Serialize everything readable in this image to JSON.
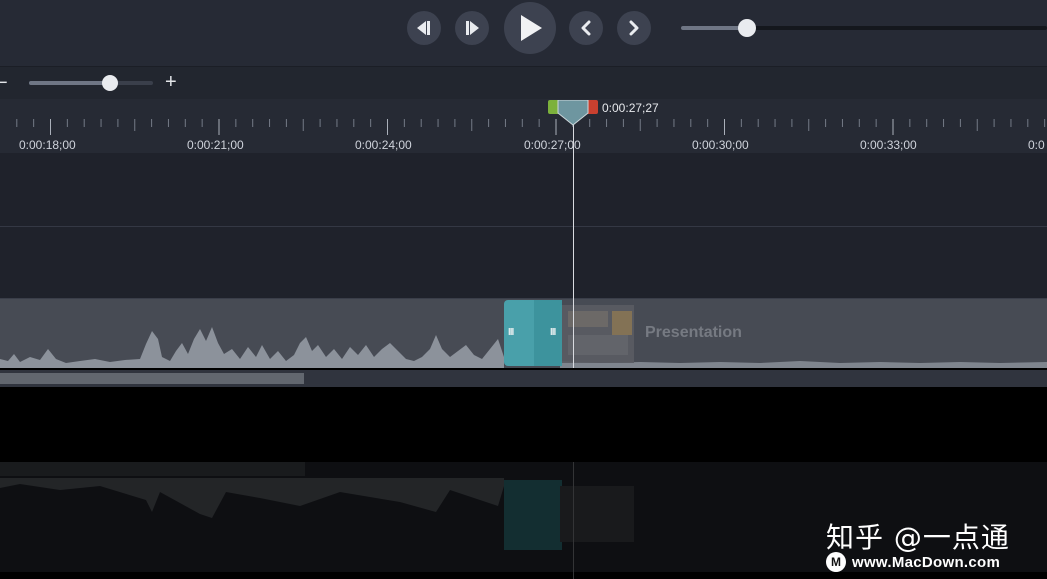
{
  "player": {
    "buttons": [
      {
        "name": "step-back-button",
        "icon": "skip-back-icon"
      },
      {
        "name": "step-forward-button",
        "icon": "skip-forward-icon"
      },
      {
        "name": "play-button",
        "icon": "play-icon"
      },
      {
        "name": "previous-button",
        "icon": "chevron-left-icon"
      },
      {
        "name": "next-button",
        "icon": "chevron-right-icon"
      }
    ],
    "progress_fraction": 0.18
  },
  "zoom": {
    "minus_label": "−",
    "plus_label": "+",
    "level_fraction": 0.65
  },
  "timeline": {
    "ruler_labels": [
      "0:00:18;00",
      "0:00:21;00",
      "0:00:24;00",
      "0:00:27;00",
      "0:00:30;00",
      "0:00:33;00",
      "0:0"
    ],
    "playhead_time": "0:00:27;27",
    "clip_label": "Presentation",
    "transition_grip": "III",
    "scroll_fraction": 0.29
  },
  "watermark": {
    "brand": "知乎 @一点通",
    "logo_letter": "M",
    "url": "www.MacDown.com"
  },
  "colors": {
    "panel": "#262a35",
    "track": "#1f222b",
    "clip": "#474b54",
    "transition": "#4aa8b2",
    "playhead_in": "#7cb13c",
    "playhead_out": "#c9402f"
  }
}
